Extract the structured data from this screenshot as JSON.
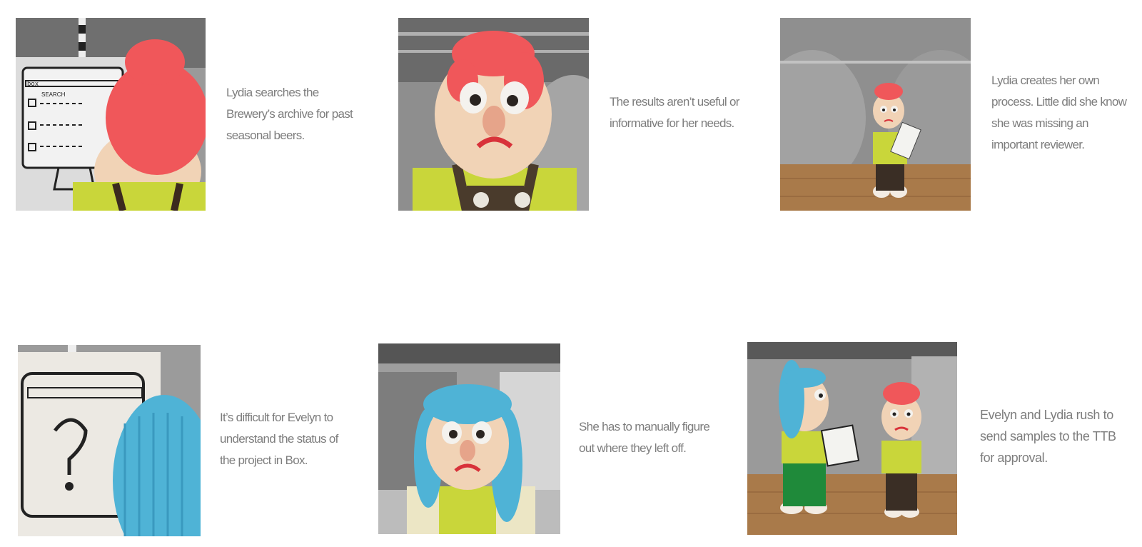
{
  "panels": [
    {
      "id": "p1",
      "image_icon": "lydia-at-computer-illustration",
      "screen_text": {
        "box": "box",
        "search": "SEARCH"
      },
      "caption": "Lydia searches the Brewery’s archive for past seasonal beers."
    },
    {
      "id": "p2",
      "image_icon": "lydia-frowning-illustration",
      "caption": "The results aren’t useful or informative for her needs."
    },
    {
      "id": "p3",
      "image_icon": "lydia-with-secret-recipe-illustration",
      "caption": "Lydia creates her own process. Little did she know she was missing an important reviewer."
    },
    {
      "id": "p4",
      "image_icon": "evelyn-confused-at-computer-illustration",
      "caption": "It’s difficult for Evelyn to understand the status of the project in Box."
    },
    {
      "id": "p5",
      "image_icon": "evelyn-frowning-illustration",
      "caption": "She has to manually figure out where they left off."
    },
    {
      "id": "p6",
      "image_icon": "evelyn-and-lydia-with-samples-illustration",
      "caption": "Evelyn and Lydia rush to send samples to the TTB for approval."
    }
  ],
  "colors": {
    "caption_text": "#7d7d7d",
    "lydia_hair": "#f0575a",
    "evelyn_hair": "#4fb3d6",
    "shirt_green": "#c9d63a",
    "skin": "#f1d3b6"
  }
}
